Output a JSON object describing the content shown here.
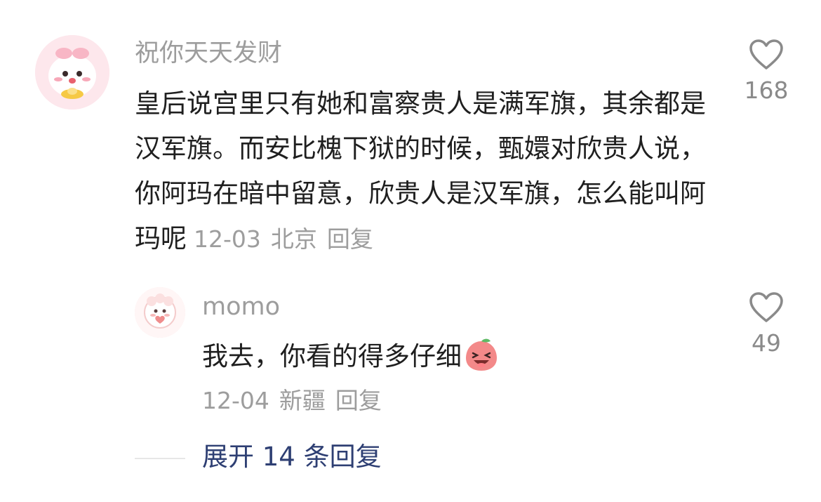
{
  "comment": {
    "username": "祝你天天发财",
    "text": "皇后说宫里只有她和富察贵人是满军旗，其余都是汉军旗。而安比槐下狱的时候，甄嬛对欣贵人说，你阿玛在暗中留意，欣贵人是汉军旗，怎么能叫阿玛呢",
    "date": "12-03",
    "location": "北京",
    "reply_label": "回复",
    "like_count": "168"
  },
  "reply": {
    "username": "momo",
    "text": "我去，你看的得多仔细",
    "emoji": "laughing-face-emoji",
    "date": "12-04",
    "location": "新疆",
    "reply_label": "回复",
    "like_count": "49"
  },
  "expand": {
    "label": "展开 14 条回复"
  },
  "colors": {
    "text": "#1f1f1f",
    "meta": "#9d9d9d",
    "link": "#2e3f73"
  }
}
